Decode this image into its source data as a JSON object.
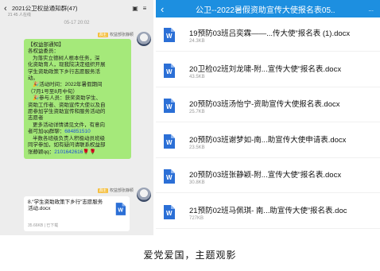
{
  "left_chat": {
    "header_title": "2021公卫权益通知群(47)",
    "header_sub": "21 45 人在线",
    "timestamp": "05-17 20:02",
    "sender1": {
      "tag": "群主",
      "name": "权益部张静颖"
    },
    "message_lines": [
      "【权益部通知】",
      "各权益委员：",
      "为落实立德树人根本任务，深",
      "化资助育人，现我院决定组织开展",
      "学生资助政策下乡行志愿服务活",
      "动。",
      "🎉活动时间：2022年暑假期间",
      "（7月1号至8月中旬）",
      "🎉参与人员：获奖资助学生、",
      "资助工作者、资助宣传大使以及自",
      "愿参加学生资助宣传和服务活动的",
      "志愿者",
      "更多活动详情请见文件，有意向",
      "者可加qq群聊：",
      "半数各班级负责人积极动员班级",
      "同学参加，如有疑问请联系权益部",
      "张静颖qq："
    ],
    "qq_group": "684851510",
    "qq_contact": "2101642616",
    "sender2": {
      "tag": "群主",
      "name": "权益部张静颖"
    },
    "file": {
      "name": "8.“学生资助政策下乡行”志愿服务活动.docx",
      "meta": "35.66KB | 已下载"
    }
  },
  "right_files": {
    "header_title": "公卫--2022暑假资助宣传大使报名表05..",
    "header_more": "...",
    "files": [
      {
        "name": "19预防03班吕奕霖——...传大使”报名表 (1).docx",
        "size": "24.3KB"
      },
      {
        "name": "20卫检02班刘龙啸-附...宣传大使”报名表.docx",
        "size": "43.5KB"
      },
      {
        "name": "20预防03班汤怡宁-资助宣传大使报名表.docx",
        "size": "25.7KB"
      },
      {
        "name": "20预防03班谢梦如-南...助宣传大使申请表.docx",
        "size": "23.5KB"
      },
      {
        "name": "20预防03班张静颖-附...宣传大使”报名表.docx",
        "size": "30.8KB"
      },
      {
        "name": "21预防02班马佩琪- 南...助宣传大使”报名表.doc",
        "size": "727KB"
      }
    ]
  },
  "caption": "爱党爱国，主题观影"
}
